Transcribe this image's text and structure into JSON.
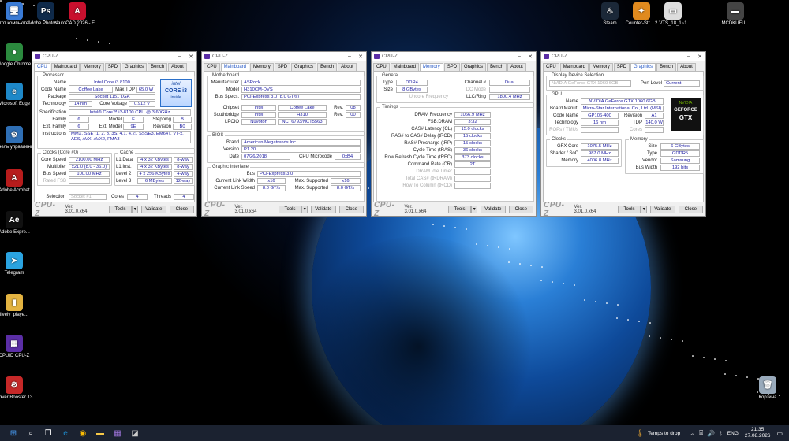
{
  "desktop_left": [
    {
      "label": "Этот компьюте...",
      "icon": "this-pc-icon",
      "color": "#3a7bd5",
      "glyph": "🖥"
    },
    {
      "label": "Adobe Photosh...",
      "icon": "photoshop-icon",
      "color": "#0f2a4a",
      "glyph": "Ps"
    },
    {
      "label": "AutoCAD 2026 - E...",
      "icon": "autocad-icon",
      "color": "#c8102e",
      "glyph": "A"
    },
    {
      "label": "Google Chrome",
      "icon": "chrome-icon",
      "color": "#2b8a3e",
      "glyph": "●"
    },
    {
      "label": "Microsoft Edge",
      "icon": "edge-icon",
      "color": "#1e88c8",
      "glyph": "e"
    },
    {
      "label": "Панель управления",
      "icon": "control-panel-icon",
      "color": "#2f6fb5",
      "glyph": "⚙"
    },
    {
      "label": "Adobe Acrobat",
      "icon": "acrobat-icon",
      "color": "#b71c1c",
      "glyph": "A"
    },
    {
      "label": "Adobe Expre...",
      "icon": "adobe-express-icon",
      "color": "#111",
      "glyph": "Ae"
    },
    {
      "label": "Telegram",
      "icon": "telegram-icon",
      "color": "#2aa3e0",
      "glyph": "➤"
    },
    {
      "label": "lively_playe...",
      "icon": "folder-icon",
      "color": "#e3b341",
      "glyph": "▮"
    },
    {
      "label": "CPUID CPU-Z",
      "icon": "cpuz-icon",
      "color": "#5b2ea6",
      "glyph": "▦"
    },
    {
      "label": "Driver Booster 13",
      "icon": "driver-booster-icon",
      "color": "#c62828",
      "glyph": "⚙"
    }
  ],
  "desktop_right": [
    {
      "label": "Steam",
      "icon": "steam-icon",
      "color": "#1b2838",
      "glyph": "♨"
    },
    {
      "label": "Counter-Str... 2",
      "icon": "cs2-icon",
      "color": "#e08a1e",
      "glyph": "✦"
    },
    {
      "label": "VTS_18_1~1",
      "icon": "video-file-icon",
      "color": "#ddd",
      "glyph": "▭"
    },
    {
      "label": "MCDKUFU...",
      "icon": "image-file-icon",
      "color": "#444",
      "glyph": "▬"
    },
    {
      "label": "Корзина",
      "icon": "recycle-bin-icon",
      "color": "#9ab",
      "glyph": "🗑"
    }
  ],
  "app": {
    "title": "CPU-Z",
    "brand": "CPU-Z",
    "version": "Ver. 3.01.0.x64",
    "tools": "Tools",
    "validate": "Validate",
    "close": "Close"
  },
  "tabs": [
    "CPU",
    "Mainboard",
    "Memory",
    "SPD",
    "Graphics",
    "Bench",
    "About"
  ],
  "cpu": {
    "processor_group": "Processor",
    "name_l": "Name",
    "name": "Intel Core i3 8100",
    "codename_l": "Code Name",
    "codename": "Coffee Lake",
    "maxtdp_l": "Max TDP",
    "maxtdp": "65.0 W",
    "package_l": "Package",
    "package": "Socket 1151 LGA",
    "tech_l": "Technology",
    "tech": "14 nm",
    "corev_l": "Core Voltage",
    "corev": "0.912 V",
    "spec_l": "Specification",
    "spec": "Intel® Core™ i3-8100 CPU @ 3.60GHz",
    "family_l": "Family",
    "family": "6",
    "model_l": "Model",
    "model": "E",
    "stepping_l": "Stepping",
    "stepping": "B",
    "extfamily_l": "Ext. Family",
    "extfamily": "6",
    "extmodel_l": "Ext. Model",
    "extmodel": "9E",
    "revision_l": "Revision",
    "revision": "B0",
    "instr_l": "Instructions",
    "instr": "MMX, SSE (1, 2, 3, 3S, 4.1, 4.2), SSSE3, EM64T, VT-x, AES, AVX, AVX2, FMA3",
    "clocks_group": "Clocks (Core #0)",
    "corespeed_l": "Core Speed",
    "corespeed": "2100.00 MHz",
    "mult_l": "Multiplier",
    "mult": "x21.0 (8.0 - 36.0)",
    "bus_l": "Bus Speed",
    "bus": "100.00 MHz",
    "fsb_l": "Rated FSB",
    "cache_group": "Cache",
    "l1d_l": "L1 Data",
    "l1d": "4 x 32 KBytes",
    "l1d_w": "8-way",
    "l1i_l": "L1 Inst.",
    "l1i": "4 x 32 KBytes",
    "l1i_w": "8-way",
    "l2_l": "Level 2",
    "l2": "4 x 256 KBytes",
    "l2_w": "4-way",
    "l3_l": "Level 3",
    "l3": "6 MBytes",
    "l3_w": "12-way",
    "sel_l": "Selection",
    "sel": "Socket #1",
    "cores_l": "Cores",
    "cores": "4",
    "threads_l": "Threads",
    "threads": "4",
    "logo_top": "intel",
    "logo_mid": "CORE i3",
    "logo_bot": "inside"
  },
  "mainboard": {
    "mb_group": "Motherboard",
    "manuf_l": "Manufacturer",
    "manuf": "ASRock",
    "model_l": "Model",
    "model": "H310CM-DVS",
    "busspecs_l": "Bus Specs.",
    "busspecs": "PCI-Express 3.0 (8.0 GT/s)",
    "chipset_l": "Chipset",
    "chipset": "Intel",
    "chipset2": "Coffee Lake",
    "rev_l": "Rev.",
    "chipset_rev": "08",
    "south_l": "Southbridge",
    "south": "Intel",
    "south2": "H310",
    "south_rev": "00",
    "lpcio_l": "LPCIO",
    "lpcio": "Nuvoton",
    "lpcio2": "NCT6793/NCT5563",
    "bios_group": "BIOS",
    "brand_l": "Brand",
    "brand": "American Megatrends Inc.",
    "version_l": "Version",
    "version": "P1.20",
    "date_l": "Date",
    "date": "07/26/2018",
    "micro_l": "CPU Microcode",
    "micro": "0xB4",
    "gi_group": "Graphic Interface",
    "gbus_l": "Bus",
    "gbus": "PCI-Express 3.0",
    "clw_l": "Current Link Width",
    "clw": "x16",
    "msw_l": "Max. Supported",
    "msw": "x16",
    "cls_l": "Current Link Speed",
    "cls": "8.0 GT/s",
    "mss_l": "Max. Supported",
    "mss": "8.0 GT/s"
  },
  "memory": {
    "gen_group": "General",
    "type_l": "Type",
    "type": "DDR4",
    "chan_l": "Channel #",
    "chan": "Dual",
    "size_l": "Size",
    "size": "8 GBytes",
    "dcmode_l": "DC Mode",
    "uncore_l": "Uncore Frequency",
    "llc_l": "LLC/Ring",
    "llc": "1800.4 MHz",
    "tim_group": "Timings",
    "dram_l": "DRAM Frequency",
    "dram": "1066.9 MHz",
    "fsbdram_l": "FSB:DRAM",
    "fsbdram": "3:32",
    "cl_l": "CAS# Latency (CL)",
    "cl": "15.0 clocks",
    "trcd_l": "RAS# to CAS# Delay (tRCD)",
    "trcd": "15 clocks",
    "trp_l": "RAS# Precharge (tRP)",
    "trp": "15 clocks",
    "tras_l": "Cycle Time (tRAS)",
    "tras": "36 clocks",
    "trfc_l": "Row Refresh Cycle Time (tRFC)",
    "trfc": "373 clocks",
    "cr_l": "Command Rate (CR)",
    "cr": "2T",
    "idle_l": "DRAM Idle Timer",
    "tcas_l": "Total CAS# (tRDRAM)",
    "rtc_l": "Row To Column (tRCD)"
  },
  "graphics": {
    "dds_group": "Display Device Selection",
    "device": "NVIDIA GeForce GTX 1060 6GB",
    "perf_l": "Perf Level",
    "perf": "Current",
    "gpu_group": "GPU",
    "name_l": "Name",
    "name": "NVIDIA GeForce GTX 1060 6GB",
    "board_l": "Board Manuf.",
    "board": "Micro-Star International Co., Ltd. (MSI)",
    "code_l": "Code Name",
    "code": "GP106-400",
    "rev_l": "Revision",
    "rev": "A1",
    "tech_l": "Technology",
    "tech": "16 nm",
    "tdp_l": "TDP",
    "tdp": "140.0 W",
    "rops_l": "ROPs / TMUs",
    "cores_l": "Cores",
    "clk_group": "Clocks",
    "gfx_l": "GFX Core",
    "gfx": "1075.5 MHz",
    "shader_l": "Shader / SoC",
    "shader": "987.0 MHz",
    "mem_l": "Memory",
    "mem": "4006.8 MHz",
    "mem_group": "Memory",
    "msize_l": "Size",
    "msize": "6 GBytes",
    "mtype_l": "Type",
    "mtype": "GDDR5",
    "vendor_l": "Vendor",
    "vendor": "Samsung",
    "bw_l": "Bus Width",
    "bw": "192 bits",
    "logo_top": "NVIDIA",
    "logo_mid": "GEFORCE",
    "logo_bot": "GTX"
  },
  "taskbar": {
    "search_hint": "Temps to drop",
    "lang": "ENG",
    "time": "21:35",
    "date": "27.08.2026"
  }
}
